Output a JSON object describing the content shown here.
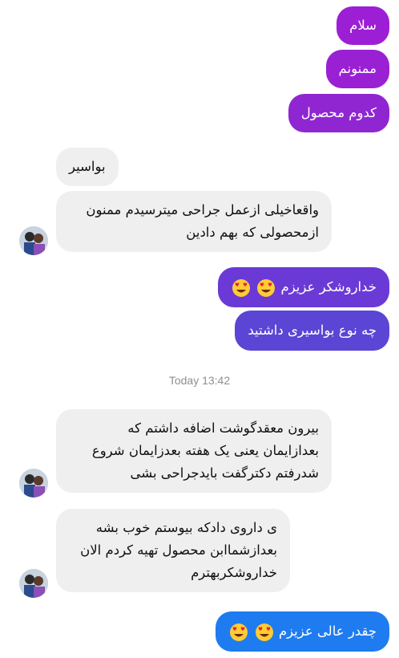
{
  "thread": {
    "outgoing_1": {
      "text": "سلام",
      "color": "#9c1fd6"
    },
    "outgoing_2": {
      "text": "ممنونم",
      "color": "#9a20d4"
    },
    "outgoing_3": {
      "text": "کدوم محصول",
      "color": "#8f26d2"
    },
    "incoming_1": {
      "text": "بواسیر"
    },
    "incoming_2": {
      "lines": [
        "واقعاخیلی ازعمل جراحی میترسیدم ممنون",
        "ازمحصولی که بهم دادین"
      ]
    },
    "outgoing_4": {
      "text": "خداروشکر عزیزم",
      "emoji": "heart-eyes-emoji",
      "color": "#6b3ad6"
    },
    "outgoing_5": {
      "text": "چه نوع بواسیری داشتید",
      "color": "#5b45d4"
    },
    "timestamp": "Today 13:42",
    "incoming_3": {
      "lines": [
        "بیرون معقدگوشت اضافه داشتم که",
        "بعدازایمان یعنی یک هفته بعدزایمان شروع",
        "شدرفتم دکترگفت بایدجراحی بشی"
      ]
    },
    "incoming_4": {
      "lines": [
        "ی داروی دادکه بیوستم خوب بشه",
        "بعدازشماابن محصول تهیه کردم الان",
        "خداروشکربهترم"
      ]
    },
    "outgoing_6": {
      "text": "چقدر عالی عزیزم",
      "emoji": "heart-eyes-emoji",
      "color": "#1e7cf0"
    }
  }
}
